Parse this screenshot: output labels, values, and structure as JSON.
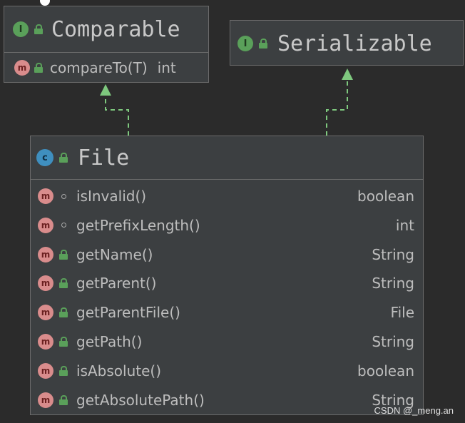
{
  "comparable": {
    "title": "Comparable",
    "badge": "I",
    "method": {
      "badge": "m",
      "name": "compareTo(T)",
      "type": "int"
    }
  },
  "serializable": {
    "title": "Serializable",
    "badge": "I"
  },
  "file": {
    "title": "File",
    "badge": "c",
    "members": [
      {
        "badge": "m",
        "visibility": "package",
        "name": "isInvalid()",
        "type": "boolean"
      },
      {
        "badge": "m",
        "visibility": "package",
        "name": "getPrefixLength()",
        "type": "int"
      },
      {
        "badge": "m",
        "visibility": "public",
        "name": "getName()",
        "type": "String"
      },
      {
        "badge": "m",
        "visibility": "public",
        "name": "getParent()",
        "type": "String"
      },
      {
        "badge": "m",
        "visibility": "public",
        "name": "getParentFile()",
        "type": "File"
      },
      {
        "badge": "m",
        "visibility": "public",
        "name": "getPath()",
        "type": "String"
      },
      {
        "badge": "m",
        "visibility": "public",
        "name": "isAbsolute()",
        "type": "boolean"
      },
      {
        "badge": "m",
        "visibility": "public",
        "name": "getAbsolutePath()",
        "type": "String"
      }
    ]
  },
  "colors": {
    "background": "#2b2b2b",
    "box_fill": "#3c3f41",
    "arrow": "#7ec87e",
    "interface_badge": "#5aa05a",
    "class_badge": "#3f8fbf",
    "method_badge": "#d98c8c"
  },
  "watermark": "CSDN @_meng.an"
}
